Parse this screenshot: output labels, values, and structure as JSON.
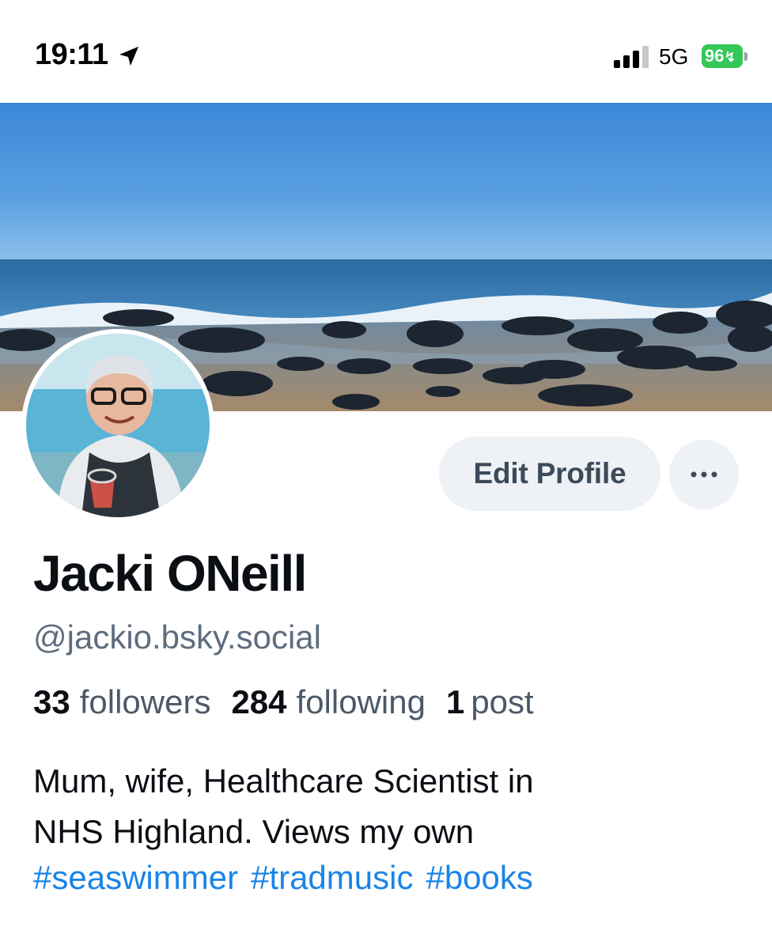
{
  "status_bar": {
    "time": "19:11",
    "network": "5G",
    "battery_level": "96",
    "location_icon": "location-arrow-icon",
    "signal_icon": "cellular-signal-icon",
    "battery_icon": "battery-charging-icon"
  },
  "profile": {
    "display_name": "Jacki ONeill",
    "handle": "@jackio.bsky.social",
    "stats": [
      {
        "count": "33",
        "label": "followers"
      },
      {
        "count": "284",
        "label": "following"
      },
      {
        "count": "1",
        "label": "post"
      }
    ],
    "bio_lines": [
      "Mum, wife, Healthcare Scientist in",
      "NHS Highland. Views my own"
    ],
    "hashtags": [
      "#seaswimmer",
      "#tradmusic",
      "#books"
    ]
  },
  "actions": {
    "edit_profile_label": "Edit Profile",
    "more_label": "•••"
  },
  "colors": {
    "accent": "#1a84e8",
    "button_bg": "#eef1f5",
    "battery_green": "#34c759",
    "secondary_text": "#5e6d7e"
  }
}
